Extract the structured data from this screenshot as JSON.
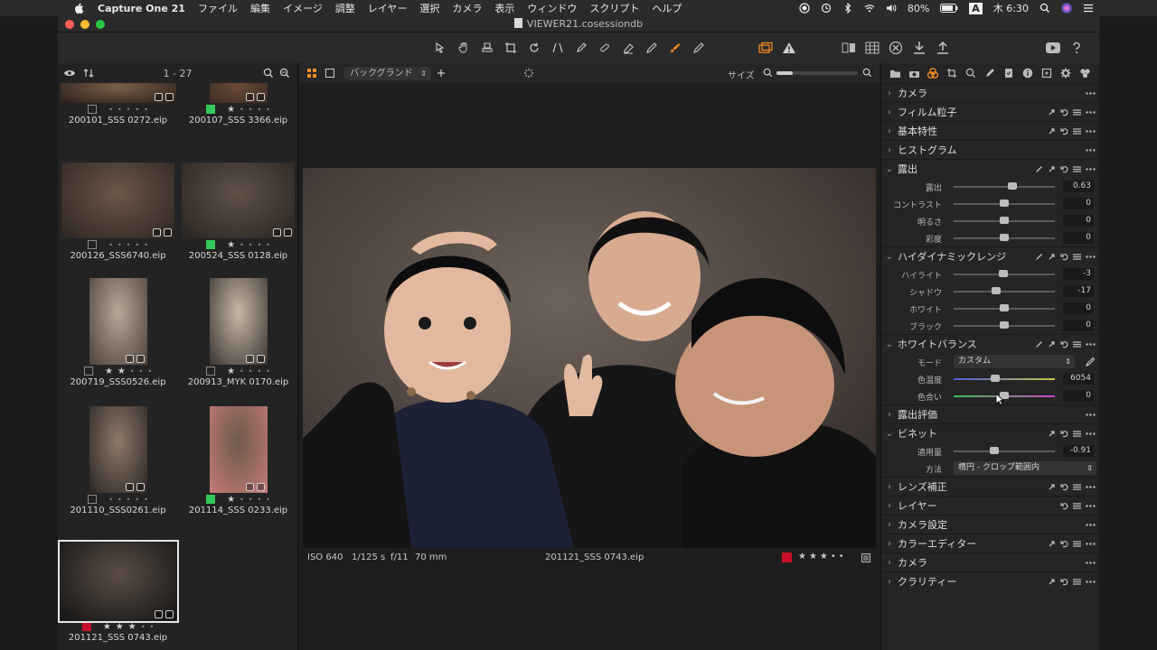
{
  "menubar": {
    "app_name": "Capture One 21",
    "items": [
      "ファイル",
      "編集",
      "イメージ",
      "調整",
      "レイヤー",
      "選択",
      "カメラ",
      "表示",
      "ウィンドウ",
      "スクリプト",
      "ヘルプ"
    ],
    "battery": "80%",
    "input_method": "A",
    "clock": "木 6:30"
  },
  "window": {
    "title": "VIEWER21.cosessiondb"
  },
  "browser": {
    "count": "1 - 27",
    "thumbnails": [
      {
        "file": "200101_SSS 0272.eip",
        "label_color": "none",
        "stars": 0
      },
      {
        "file": "200107_SSS 3366.eip",
        "label_color": "green",
        "stars": 1
      },
      {
        "file": "200126_SSS6740.eip",
        "label_color": "none",
        "stars": 0
      },
      {
        "file": "200524_SSS 0128.eip",
        "label_color": "green",
        "stars": 1
      },
      {
        "file": "200719_SSS0526.eip",
        "label_color": "none",
        "stars": 2
      },
      {
        "file": "200913_MYK 0170.eip",
        "label_color": "none",
        "stars": 1
      },
      {
        "file": "201110_SSS0261.eip",
        "label_color": "none",
        "stars": 0
      },
      {
        "file": "201114_SSS 0233.eip",
        "label_color": "green",
        "stars": 1
      },
      {
        "file": "201121_SSS 0743.eip",
        "label_color": "red",
        "stars": 3
      }
    ]
  },
  "viewer": {
    "background_select": "バックグランド",
    "size_label": "サイズ",
    "iso": "ISO 640",
    "shutter": "1/125 s",
    "aperture": "f/11",
    "focal": "70 mm",
    "file": "201121_SSS 0743.eip",
    "label_color": "#c8102e",
    "stars": 3
  },
  "tools": {
    "sections": {
      "camera": "カメラ",
      "film_grain": "フィルム粒子",
      "base_char": "基本特性",
      "histogram": "ヒストグラム",
      "exposure": "露出",
      "hdr": "ハイダイナミックレンジ",
      "white_balance": "ホワイトバランス",
      "exposure_eval": "露出評価",
      "vignette": "ビネット",
      "lens": "レンズ補正",
      "layers": "レイヤー",
      "camera_settings": "カメラ設定",
      "color_editor": "カラーエディター",
      "camera2": "カメラ",
      "clarity": "クラリティー"
    },
    "exposure": [
      {
        "label": "露出",
        "value": "0.63",
        "pos": 0.58
      },
      {
        "label": "コントラスト",
        "value": "0",
        "pos": 0.5
      },
      {
        "label": "明るさ",
        "value": "0",
        "pos": 0.5
      },
      {
        "label": "彩度",
        "value": "0",
        "pos": 0.5
      }
    ],
    "hdr": [
      {
        "label": "ハイライト",
        "value": "-3",
        "pos": 0.49
      },
      {
        "label": "シャドウ",
        "value": "-17",
        "pos": 0.42
      },
      {
        "label": "ホワイト",
        "value": "0",
        "pos": 0.5
      },
      {
        "label": "ブラック",
        "value": "0",
        "pos": 0.5
      }
    ],
    "white_balance": {
      "mode_label": "モード",
      "mode_value": "カスタム",
      "kelvin_label": "色温度",
      "kelvin_value": "6054",
      "kelvin_pos": 0.41,
      "tint_label": "色合い",
      "tint_value": "0",
      "tint_pos": 0.5
    },
    "vignette": {
      "amount_label": "適用量",
      "amount_value": "-0.91",
      "amount_pos": 0.4,
      "method_label": "方法",
      "method_value": "楕円 - クロップ範囲内"
    }
  }
}
